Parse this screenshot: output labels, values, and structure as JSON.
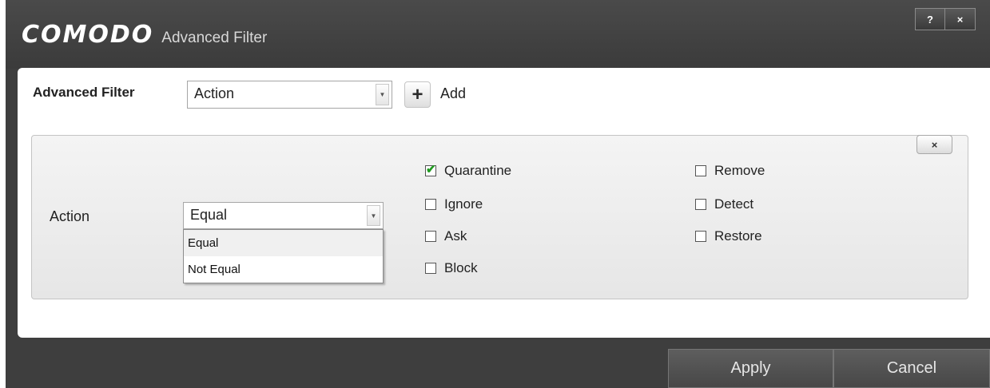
{
  "window": {
    "brand": "COMODO",
    "title": "Advanced Filter",
    "help_label": "?",
    "close_label": "×"
  },
  "filter": {
    "label": "Advanced Filter",
    "selected": "Action",
    "add_label": "Add"
  },
  "rule": {
    "close_label": "×",
    "field_label": "Action",
    "operator_value": "Equal",
    "operator_options": [
      "Equal",
      "Not Equal"
    ],
    "checkboxes": [
      {
        "label": "Quarantine",
        "checked": true
      },
      {
        "label": "Ignore",
        "checked": false
      },
      {
        "label": "Ask",
        "checked": false
      },
      {
        "label": "Block",
        "checked": false
      },
      {
        "label": "Remove",
        "checked": false
      },
      {
        "label": "Detect",
        "checked": false
      },
      {
        "label": "Restore",
        "checked": false
      }
    ]
  },
  "footer": {
    "apply_label": "Apply",
    "cancel_label": "Cancel"
  }
}
